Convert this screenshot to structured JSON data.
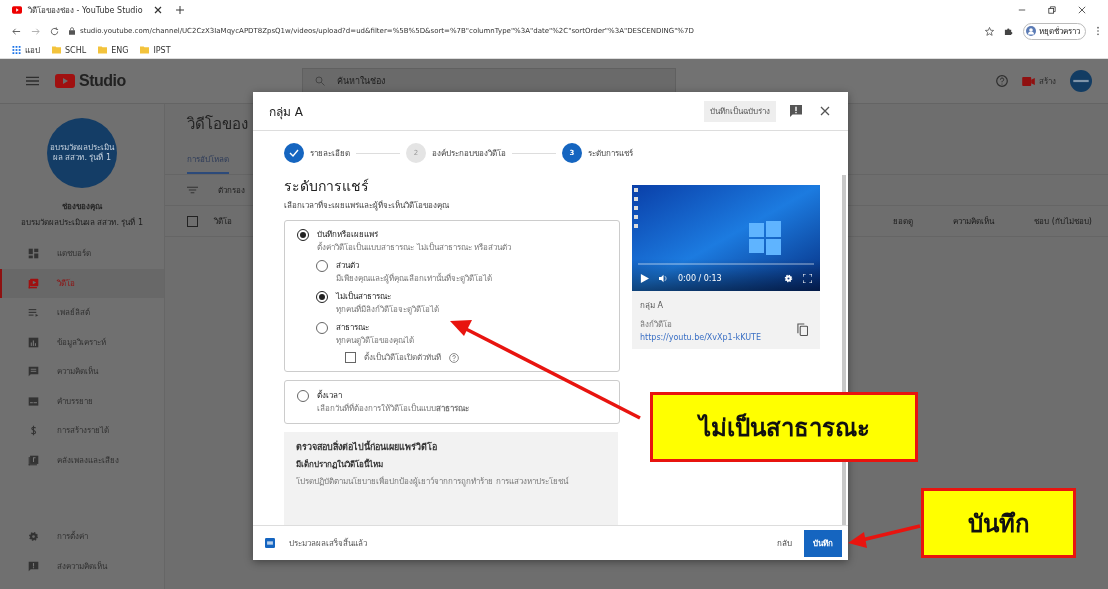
{
  "browser": {
    "tab_title": "วิดีโอของช่อง - YouTube Studio",
    "url": "studio.youtube.com/channel/UC2CzX3IaMqycAPDT8ZpsQ1w/videos/upload?d=ud&filter=%5B%5D&sort=%7B\"columnType\"%3A\"date\"%2C\"sortOrder\"%3A\"DESCENDING\"%7D",
    "bookmarks": [
      "แอป",
      "SCHL",
      "ENG",
      "IPST"
    ],
    "profile_label": "หยุดชั่วคราว"
  },
  "topbar": {
    "logo": "Studio",
    "search_placeholder": "ค้นหาในช่อง",
    "create_label": "สร้าง"
  },
  "sidebar": {
    "avatar_text": "อบรมวัดผลประเมินผล สสวท. รุ่นที่ 1",
    "channel_title": "ช่องของคุณ",
    "channel_name": "อบรมวัดผลประเมินผล สสวท. รุ่นที่ 1",
    "items": [
      {
        "label": "แดชบอร์ด",
        "kind": "dashboard",
        "selected": false
      },
      {
        "label": "วิดีโอ",
        "kind": "video",
        "selected": true
      },
      {
        "label": "เพลย์ลิสต์",
        "kind": "playlist",
        "selected": false
      },
      {
        "label": "ข้อมูลวิเคราะห์",
        "kind": "analytics",
        "selected": false
      },
      {
        "label": "ความคิดเห็น",
        "kind": "comments",
        "selected": false
      },
      {
        "label": "คำบรรยาย",
        "kind": "subtitles",
        "selected": false
      },
      {
        "label": "การสร้างรายได้",
        "kind": "money",
        "selected": false
      },
      {
        "label": "คลังเพลงและเสียง",
        "kind": "audio",
        "selected": false
      }
    ],
    "bottom_items": [
      {
        "label": "การตั้งค่า",
        "kind": "settings",
        "selected": false
      },
      {
        "label": "ส่งความคิดเห็น",
        "kind": "feedback",
        "selected": false
      }
    ]
  },
  "content": {
    "title": "วิดีโอของ",
    "select_all_checked": false,
    "tabs": [
      {
        "label": "การอัปโหลด",
        "selected": true
      }
    ],
    "filter_placeholder": "ตัวกรอง",
    "columns": [
      "วิดีโอ",
      "ยอดดู",
      "ความคิดเห็น",
      "ชอบ (กับไม่ชอบ)"
    ]
  },
  "dialog": {
    "title": "กลุ่ม A",
    "draft_button": "บันทึกเป็นฉบับร่าง",
    "steps": [
      {
        "label": "รายละเอียด",
        "completed": true,
        "selected": false
      },
      {
        "number": "2",
        "label": "องค์ประกอบของวิดีโอ",
        "completed": false,
        "selected": false
      },
      {
        "number": "3",
        "label": "ระดับการแชร์",
        "completed": false,
        "selected": true
      }
    ],
    "heading": "ระดับการแชร์",
    "subheading": "เลือกเวลาที่จะเผยแพร่และผู้ที่จะเห็นวิดีโอของคุณ",
    "publish_option": {
      "label": "บันทึกหรือเผยแพร่",
      "description": "ตั้งค่าวิดีโอเป็นแบบสาธารณะ ไม่เป็นสาธารณะ หรือส่วนตัว",
      "selected": true,
      "children": [
        {
          "label": "ส่วนตัว",
          "description": "มีเพียงคุณและผู้ที่คุณเลือกเท่านั้นที่จะดูวิดีโอได้",
          "selected": false
        },
        {
          "label": "ไม่เป็นสาธารณะ",
          "description": "ทุกคนที่มีลิงก์วิดีโอจะดูวิดีโอได้",
          "selected": true
        },
        {
          "label": "สาธารณะ",
          "description": "ทุกคนดูวิดีโอของคุณได้",
          "selected": false
        }
      ],
      "premiere": {
        "label": "ตั้งเป็นวิดีโอเปิดตัวทันที",
        "checked": false
      }
    },
    "schedule_option": {
      "label": "ตั้งเวลา",
      "description": "เลือกวันที่ที่ต้องการให้วิดีโอเป็นแบบ**สาธารณะ**",
      "selected": false
    },
    "checklist": {
      "title": "ตรวจสอบสิ่งต่อไปนี้ก่อนเผยแพร่วิดีโอ",
      "question": "มีเด็กปรากฏในวิดีโอนี้ไหม",
      "text": "โปรดปฏิบัติตามนโยบายเพื่อปกป้องผู้เยาว์จากการถูกทำร้าย การแสวงหาประโยชน์"
    },
    "preview": {
      "time": "0:00 / 0:13",
      "video_title": "กลุ่ม A",
      "link_label": "ลิงก์วิดีโอ",
      "link": "https://youtu.be/XvXp1-kKUTE"
    },
    "footer": {
      "status": "ประมวลผลเสร็จสิ้นแล้ว",
      "back_button": "กลับ",
      "save_button": "บันทึก"
    }
  },
  "annotations": [
    {
      "text": "ไม่เป็นสาธารณะ"
    },
    {
      "text": "บันทึก"
    }
  ]
}
